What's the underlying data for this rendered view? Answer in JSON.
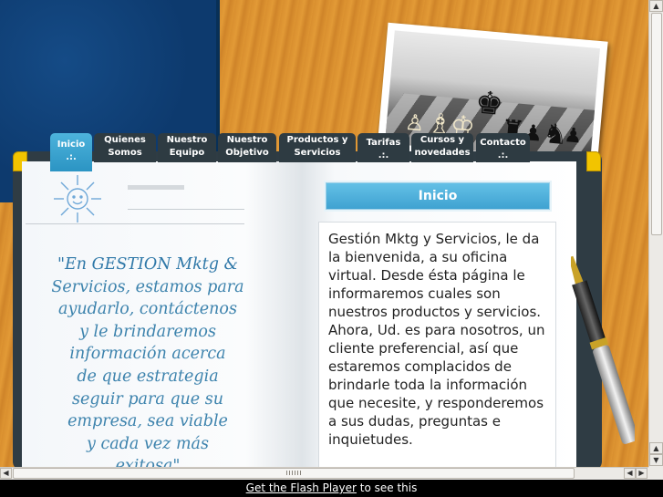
{
  "tabs": [
    {
      "line1": "Inicio",
      "line2": ".:.",
      "active": true
    },
    {
      "line1": "Quienes",
      "line2": "Somos",
      "active": false
    },
    {
      "line1": "Nuestro",
      "line2": "Equipo",
      "active": false
    },
    {
      "line1": "Nuestro",
      "line2": "Objetivo",
      "active": false
    },
    {
      "line1": "Productos y",
      "line2": "Servicios",
      "active": false
    },
    {
      "line1": "Tarifas",
      "line2": ".:.",
      "active": false
    },
    {
      "line1": "Cursos y",
      "line2": "novedades",
      "active": false
    },
    {
      "line1": "Contacto",
      "line2": ".:.",
      "active": false
    }
  ],
  "left_page": {
    "quote_lines": [
      "\"En GESTION Mktg &",
      "Servicios, estamos para",
      "ayudarlo, contáctenos",
      "y le brindaremos",
      "información acerca",
      "de que estrategia",
      "seguir  para que su",
      "empresa, sea viable",
      "y cada vez más",
      "exitosa\""
    ]
  },
  "right_page": {
    "header": "Inicio",
    "body": "Gestión Mktg y Servicios, le da la bienvenida, a su oficina virtual. Desde ésta página le informaremos cuales son nuestros productos y servicios. Ahora, Ud. es para nosotros, un cliente preferencial, así que estaremos complacidos de brindarle toda la información que necesite, y responderemos a sus dudas, preguntas e inquietudes."
  },
  "footer": {
    "link_text": "Get the Flash Player",
    "suffix": " to see this"
  },
  "colors": {
    "navy": "#0d3a6e",
    "tab_active": "#2b94c3",
    "tab": "#2e3b42",
    "quote": "#3d83ad"
  }
}
